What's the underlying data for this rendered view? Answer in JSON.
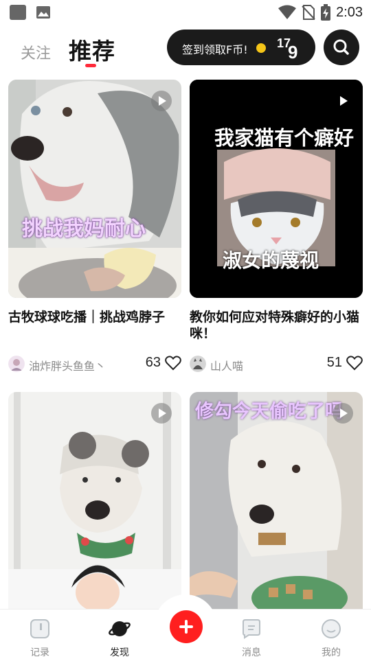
{
  "status_bar": {
    "time": "2:03",
    "icons": [
      "app-icon",
      "image-icon",
      "wifi-icon",
      "no-sim-icon",
      "battery-charging-icon"
    ]
  },
  "header": {
    "tab_follow": "关注",
    "tab_recommend": "推荐",
    "checkin_label": "签到领取F币!",
    "checkin_count_top": "17",
    "checkin_count_bottom": "9",
    "accent_color": "#ff2a3a"
  },
  "feed": [
    {
      "overlay_text": "挑战我妈耐心",
      "title": "古牧球球吃播｜挑战鸡脖子",
      "author": "油炸胖头鱼鱼丶",
      "likes": "63"
    },
    {
      "overlay_text_top": "我家猫有个癖好",
      "overlay_text_bottom": "淑女的蔑视",
      "title": "教你如何应对特殊癖好的小猫咪！",
      "author": "山人喵",
      "likes": "51"
    },
    {
      "overlay_text": "",
      "title": "",
      "author": "",
      "likes": ""
    },
    {
      "overlay_text": "修勾今天偷吃了吗",
      "title": "",
      "author": "",
      "likes": ""
    }
  ],
  "bottom_nav": {
    "items": [
      {
        "label": "记录",
        "icon": "record-icon"
      },
      {
        "label": "发现",
        "icon": "discover-planet-icon"
      },
      {
        "label": "消息",
        "icon": "message-icon"
      },
      {
        "label": "我的",
        "icon": "profile-icon"
      }
    ],
    "fab_icon": "plus-icon",
    "fab_color": "#ff1f1f"
  }
}
